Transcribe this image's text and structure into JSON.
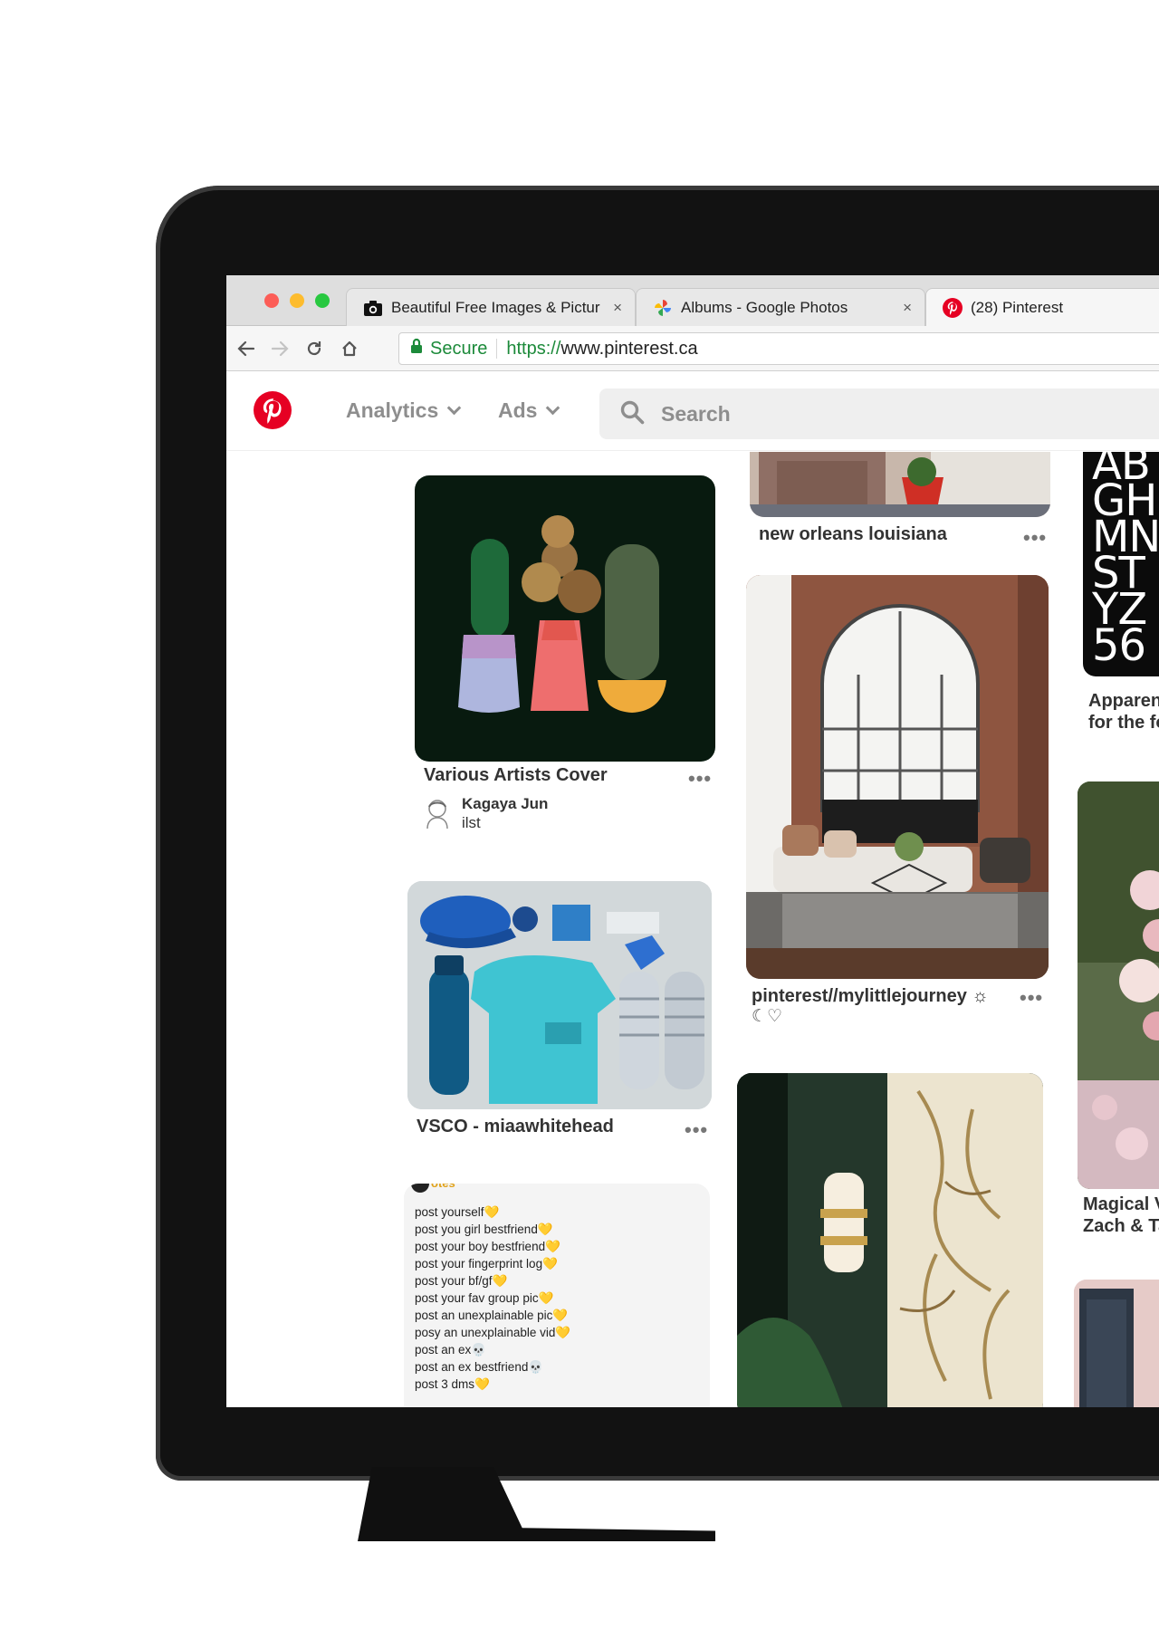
{
  "browser": {
    "tabs": [
      {
        "label": "Beautiful Free Images & Pictur",
        "icon": "camera-icon",
        "closable": true,
        "active": false
      },
      {
        "label": "Albums - Google Photos",
        "icon": "pinwheel-icon",
        "closable": true,
        "active": false
      },
      {
        "label": "(28) Pinterest",
        "icon": "pinterest-icon",
        "closable": false,
        "active": true
      }
    ],
    "close_glyph": "×",
    "secure_label": "Secure",
    "url_scheme": "https://",
    "url_host": "www.pinterest.ca"
  },
  "header": {
    "analytics_label": "Analytics",
    "ads_label": "Ads",
    "search_placeholder": "Search"
  },
  "pins": {
    "cover": {
      "title": "Various Artists Cover",
      "author": "Kagaya Jun",
      "board": "ilst"
    },
    "vsco": {
      "title": "VSCO - miaawhitehead"
    },
    "list": {
      "header": "otes",
      "lines": [
        "post yourself💛",
        "post you girl bestfriend💛",
        "post your boy bestfriend💛",
        "post your fingerprint log💛",
        "post your bf/gf💛",
        "post your fav group pic💛",
        "post an unexplainable pic💛",
        "posy an unexplainable vid💛",
        "post an ex💀",
        "post an ex bestfriend💀",
        "post 3 dms💛"
      ]
    },
    "nola": {
      "title": "new orleans louisiana"
    },
    "room": {
      "title": "pinterest//mylittlejourney ☼",
      "title_line2": "☾♡"
    },
    "type_pin": {
      "title_line1": "Apparen",
      "title_line2": "for the fo",
      "rows": [
        "AB",
        "GH",
        "MN",
        "ST",
        "YZ",
        "56"
      ]
    },
    "magical": {
      "title_line1": "Magical V",
      "title_line2": "Zach & Ta"
    }
  },
  "more_glyph": "•••",
  "colors": {
    "pinterest_red": "#e60023",
    "secure_green": "#1c8a3a",
    "header_gray": "#8e8e8e",
    "search_bg": "#efefef"
  }
}
